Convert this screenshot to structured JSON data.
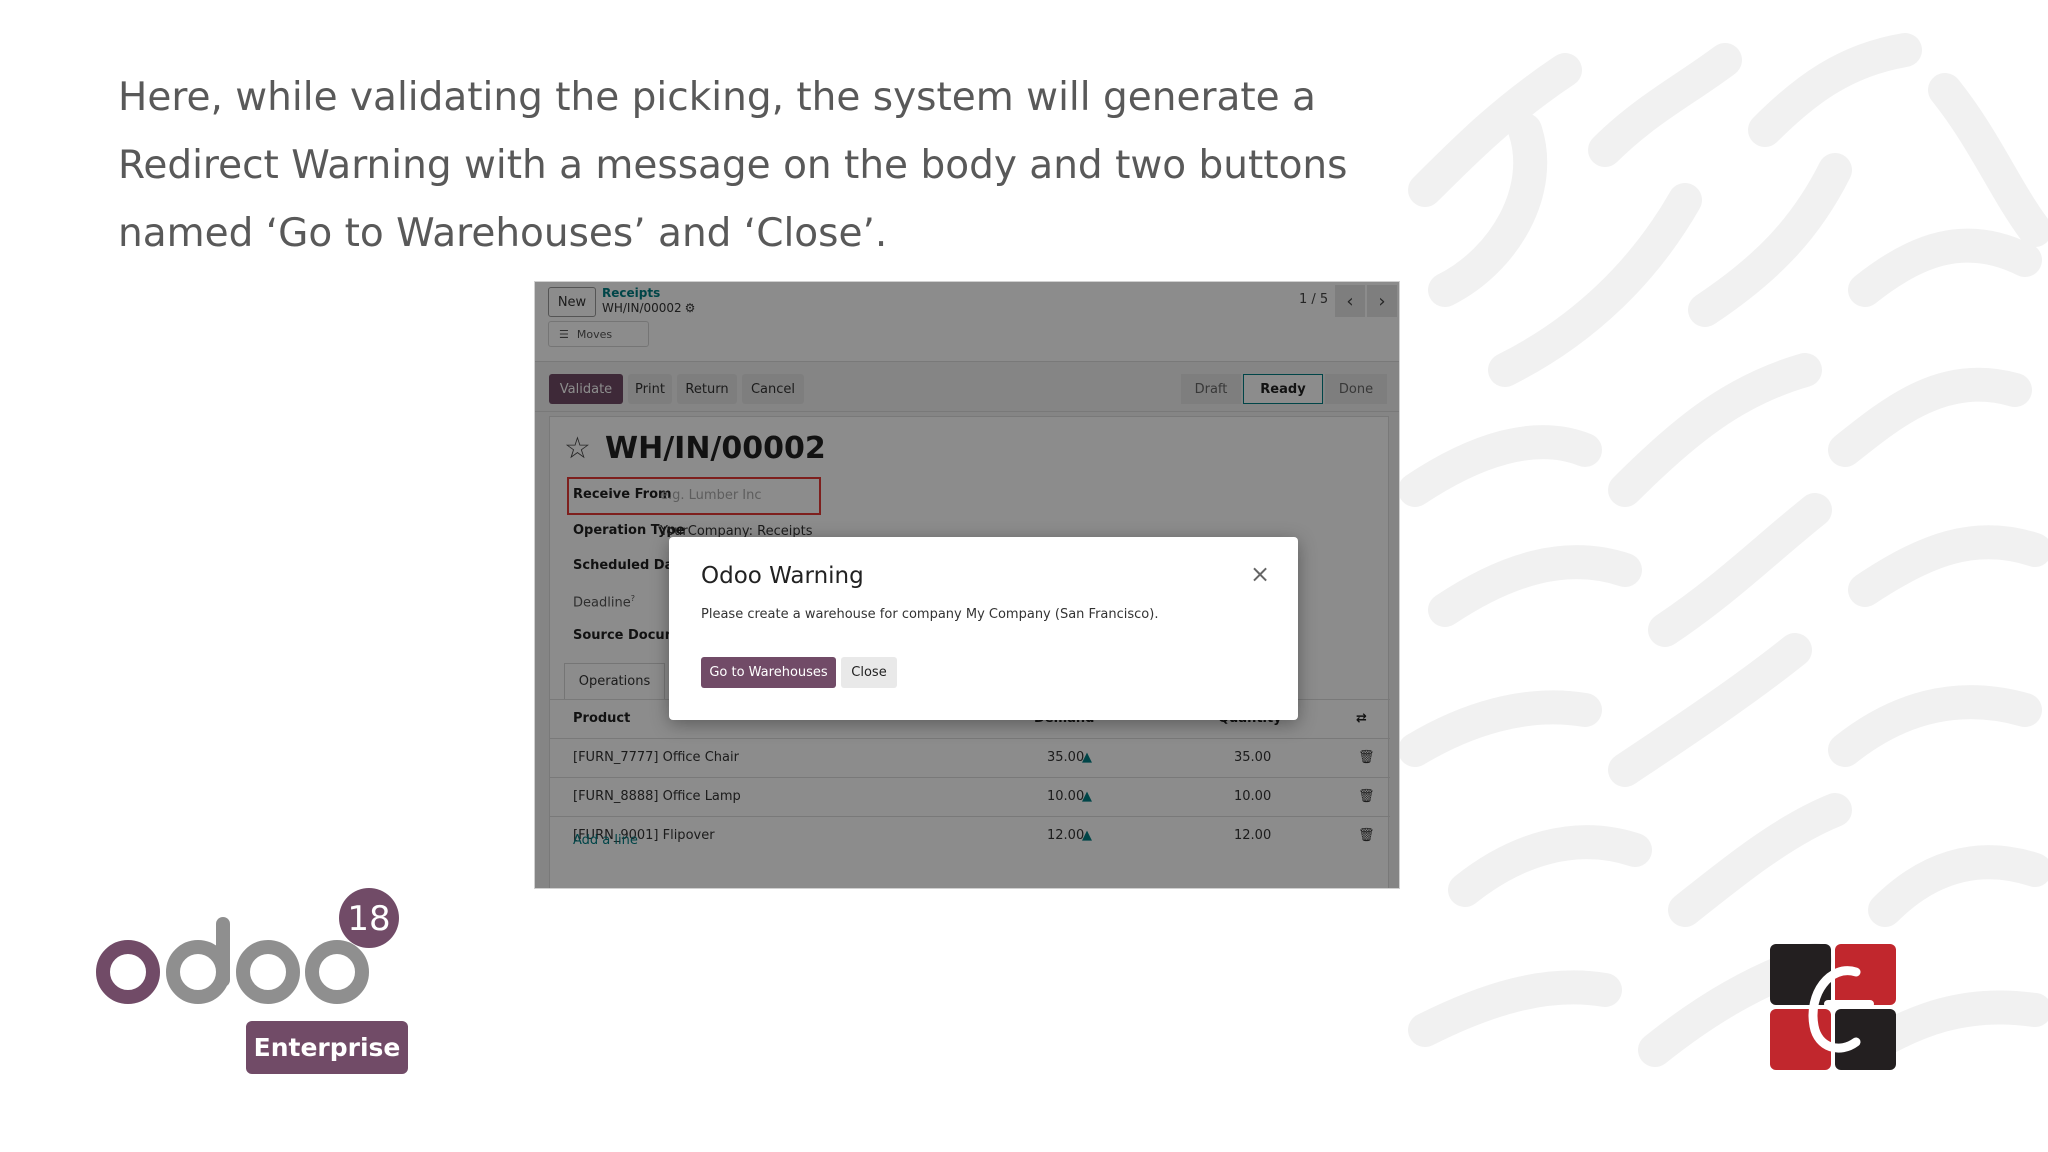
{
  "slide": {
    "text": "Here, while validating the picking, the system will generate a Redirect Warning with a message on the body and two buttons named ‘Go to Warehouses’ and ‘Close’."
  },
  "control_panel": {
    "new_label": "New",
    "breadcrumb_parent": "Receipts",
    "breadcrumb_current": "WH/IN/00002",
    "moves_label": "Moves",
    "pager": "1 / 5"
  },
  "status_bar": {
    "validate": "Validate",
    "print": "Print",
    "return": "Return",
    "cancel": "Cancel",
    "stages": [
      "Draft",
      "Ready",
      "Done"
    ],
    "active_stage": "Ready"
  },
  "record": {
    "title": "WH/IN/00002",
    "fields": {
      "receive_from_label": "Receive From",
      "receive_from_placeholder": "e.g. Lumber Inc",
      "operation_type_label": "Operation Type",
      "operation_type_value": "YourCompany: Receipts",
      "scheduled_date_label": "Scheduled Date",
      "deadline_label": "Deadline",
      "deadline_sup": "?",
      "source_document_label": "Source Documen"
    },
    "tab_operations": "Operations",
    "table": {
      "headers": [
        "Product",
        "Demand",
        "Quantity"
      ],
      "rows": [
        {
          "product": "[FURN_7777] Office Chair",
          "demand": "35.00",
          "quantity": "35.00"
        },
        {
          "product": "[FURN_8888] Office Lamp",
          "demand": "10.00",
          "quantity": "10.00"
        },
        {
          "product": "[FURN_9001] Flipover",
          "demand": "12.00",
          "quantity": "12.00"
        }
      ],
      "add_line": "Add a line"
    }
  },
  "dialog": {
    "title": "Odoo Warning",
    "body": "Please create a warehouse for company My Company (San Francisco).",
    "primary_button": "Go to Warehouses",
    "secondary_button": "Close"
  },
  "branding": {
    "logo_text": "odoo",
    "version": "18",
    "edition": "Enterprise"
  },
  "colors": {
    "brand_purple": "#714b67",
    "teal": "#017e84",
    "highlight_red": "#e53935"
  }
}
